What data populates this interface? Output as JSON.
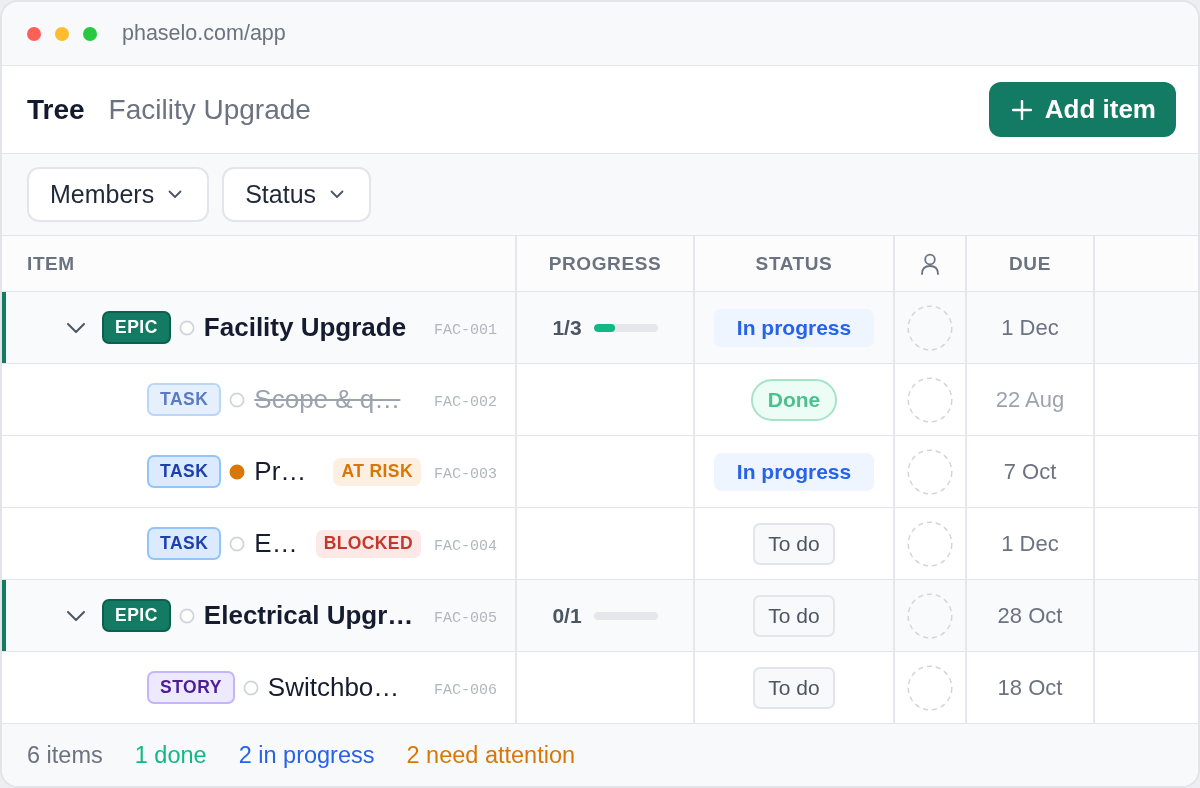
{
  "window": {
    "url": "phaselo.com/app"
  },
  "header": {
    "title": "Tree",
    "project": "Facility Upgrade",
    "action": "Add item"
  },
  "filters": [
    {
      "label": "Members"
    },
    {
      "label": "Status"
    }
  ],
  "table": {
    "columns": [
      {
        "label": "ITEM",
        "kind": "text"
      },
      {
        "label": "PROGRESS",
        "kind": "text"
      },
      {
        "label": "STATUS",
        "kind": "text"
      },
      {
        "kind": "assignee"
      },
      {
        "label": "DUE",
        "kind": "text"
      }
    ],
    "rows": [
      {
        "kind": "epic",
        "type": "EPIC",
        "expanded": true,
        "done": false,
        "dot_filled": false,
        "title": "Facility Upgrade",
        "id": "FAC-001",
        "progress": {
          "text": "1/3",
          "level": 0.333
        },
        "status": {
          "label": "In progress",
          "kind": "in_progress"
        },
        "due": "1 Dec",
        "children": [
          {
            "kind": "task",
            "type": "TASK",
            "done": true,
            "dot_filled": false,
            "title": "Scope & q…",
            "id": "FAC-002",
            "status": {
              "label": "Done",
              "kind": "done"
            },
            "due": "22 Aug"
          },
          {
            "kind": "task",
            "type": "TASK",
            "done": false,
            "dot_filled": true,
            "title": "Pr…",
            "flag": {
              "label": "AT RISK",
              "kind": "at_risk"
            },
            "id": "FAC-003",
            "status": {
              "label": "In progress",
              "kind": "in_progress"
            },
            "due": "7 Oct"
          },
          {
            "kind": "task",
            "type": "TASK",
            "done": false,
            "dot_filled": false,
            "title": "E…",
            "flag": {
              "label": "BLOCKED",
              "kind": "blocked"
            },
            "id": "FAC-004",
            "status": {
              "label": "To do",
              "kind": "todo"
            },
            "due": "1 Dec"
          }
        ]
      },
      {
        "kind": "epic",
        "type": "EPIC",
        "expanded": true,
        "done": false,
        "dot_filled": false,
        "title": "Electrical Upgr…",
        "id": "FAC-005",
        "progress": {
          "text": "0/1"
        },
        "status": {
          "label": "To do",
          "kind": "todo"
        },
        "due": "28 Oct",
        "children": [
          {
            "kind": "story",
            "type": "STORY",
            "done": false,
            "dot_filled": false,
            "title": "Switchbo…",
            "id": "FAC-006",
            "status": {
              "label": "To do",
              "kind": "todo"
            },
            "due": "18 Oct"
          }
        ]
      }
    ]
  },
  "summary": [
    {
      "label": "6 items",
      "kind": "total"
    },
    {
      "label": "1 done",
      "kind": "done"
    },
    {
      "label": "2 in progress",
      "kind": "in_progress"
    },
    {
      "label": "2 need attention",
      "kind": "attention"
    }
  ]
}
